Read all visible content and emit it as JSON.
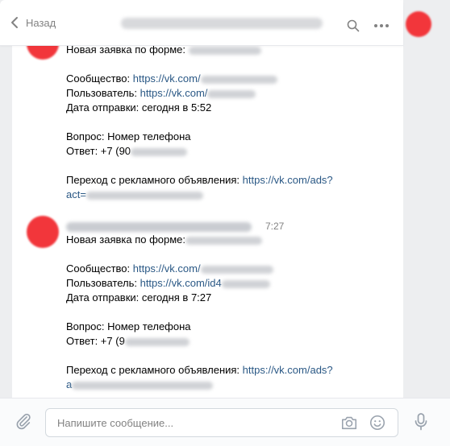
{
  "header": {
    "back_label": "Назад"
  },
  "messages": [
    {
      "lines": {
        "form": "Новая заявка по форме: ",
        "community_label": "Сообщество: ",
        "community_link": "https://vk.com/",
        "user_label": "Пользователь: ",
        "user_link": "https://vk.com/",
        "date": "Дата отправки: сегодня в 5:52",
        "question": "Вопрос: Номер телефона",
        "answer": "Ответ: +7 (90",
        "ad_label": "Переход с рекламного объявления: ",
        "ad_link": "https://vk.com/ads?",
        "ad_link_cont": "act="
      }
    },
    {
      "time": "7:27",
      "lines": {
        "form": "Новая заявка по форме:",
        "community_label": "Сообщество: ",
        "community_link": "https://vk.com/",
        "user_label": "Пользователь: ",
        "user_link": "https://vk.com/id4",
        "date": "Дата отправки: сегодня в 7:27",
        "question": "Вопрос: Номер телефона",
        "answer": "Ответ: +7 (9",
        "ad_label": "Переход с рекламного объявления: ",
        "ad_link": "https://vk.com/ads?",
        "ad_link_cont": "a"
      }
    }
  ],
  "composer": {
    "placeholder": "Напишите сообщение..."
  },
  "colors": {
    "link": "#2a5885",
    "muted": "#828282",
    "avatar": "#f2363b",
    "frame": "#edeef0"
  }
}
